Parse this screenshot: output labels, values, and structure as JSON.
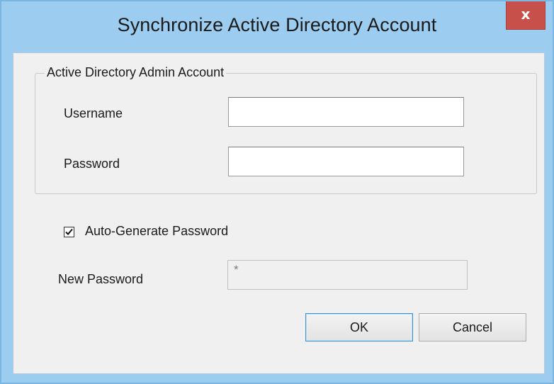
{
  "window": {
    "title": "Synchronize Active Directory Account",
    "close_label": "x"
  },
  "group": {
    "legend": "Active Directory Admin Account",
    "username_label": "Username",
    "username_value": "",
    "password_label": "Password",
    "password_value": ""
  },
  "auto_generate": {
    "label": "Auto-Generate Password",
    "checked": true
  },
  "new_password": {
    "label": "New Password",
    "value": "*"
  },
  "buttons": {
    "ok_label": "OK",
    "cancel_label": "Cancel"
  },
  "colors": {
    "title_bar": "#9ccdf0",
    "close_button": "#c7504b",
    "client_background": "#f0f0f0"
  }
}
